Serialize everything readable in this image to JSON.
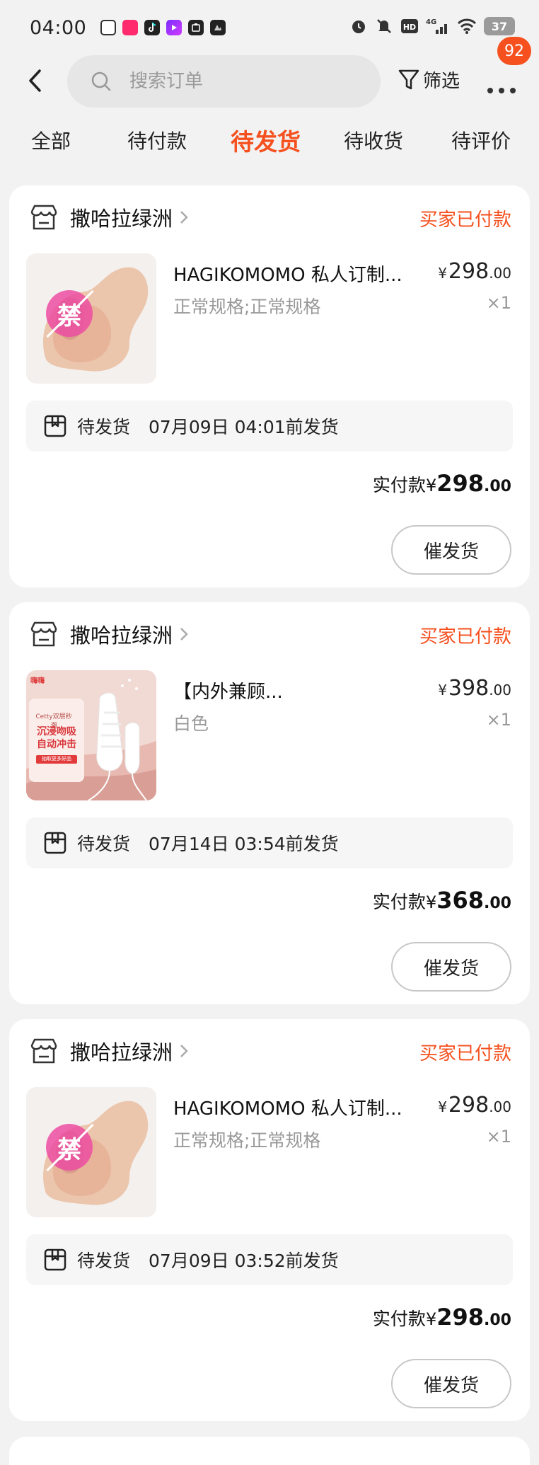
{
  "status_bar": {
    "time": "04:00",
    "battery": "37",
    "network": "4G"
  },
  "header": {
    "search_placeholder": "搜索订单",
    "filter_label": "筛选",
    "more_badge": "92"
  },
  "tabs": [
    {
      "label": "全部",
      "active": false
    },
    {
      "label": "待付款",
      "active": false
    },
    {
      "label": "待发货",
      "active": true
    },
    {
      "label": "待收货",
      "active": false
    },
    {
      "label": "待评价",
      "active": false
    }
  ],
  "orders": [
    {
      "store": "撒哈拉绿洲",
      "status": "买家已付款",
      "title": "HAGIKOMOMO 私人订制...",
      "price_currency": "¥",
      "price_int": "298",
      "price_dec": ".00",
      "spec": "正常规格;正常规格",
      "qty": "×1",
      "ship_status": "待发货",
      "ship_deadline": "07月09日 04:01前发货",
      "paid_label": "实付款",
      "paid_currency": "¥",
      "paid_int": "298",
      "paid_dec": ".00",
      "button": "催发货",
      "ban_char": "禁"
    },
    {
      "store": "撒哈拉绿洲",
      "status": "买家已付款",
      "title": "【内外兼顾...",
      "price_currency": "¥",
      "price_int": "398",
      "price_dec": ".00",
      "spec": "白色",
      "qty": "×1",
      "ship_status": "待发货",
      "ship_deadline": "07月14日 03:54前发货",
      "paid_label": "实付款",
      "paid_currency": "¥",
      "paid_int": "368",
      "paid_dec": ".00",
      "button": "催发货",
      "ad_logo": "嗨嗨",
      "ad_tag": "Cetty双层秒潮",
      "ad_headline": "沉浸吻吸 自动冲击",
      "ad_small": "抽取更多好品"
    },
    {
      "store": "撒哈拉绿洲",
      "status": "买家已付款",
      "title": "HAGIKOMOMO 私人订制...",
      "price_currency": "¥",
      "price_int": "298",
      "price_dec": ".00",
      "spec": "正常规格;正常规格",
      "qty": "×1",
      "ship_status": "待发货",
      "ship_deadline": "07月09日 03:52前发货",
      "paid_label": "实付款",
      "paid_currency": "¥",
      "paid_int": "298",
      "paid_dec": ".00",
      "button": "催发货",
      "ban_char": "禁"
    }
  ],
  "colors": {
    "accent": "#f5501e",
    "background": "#f2f2f2",
    "card": "#ffffff"
  }
}
